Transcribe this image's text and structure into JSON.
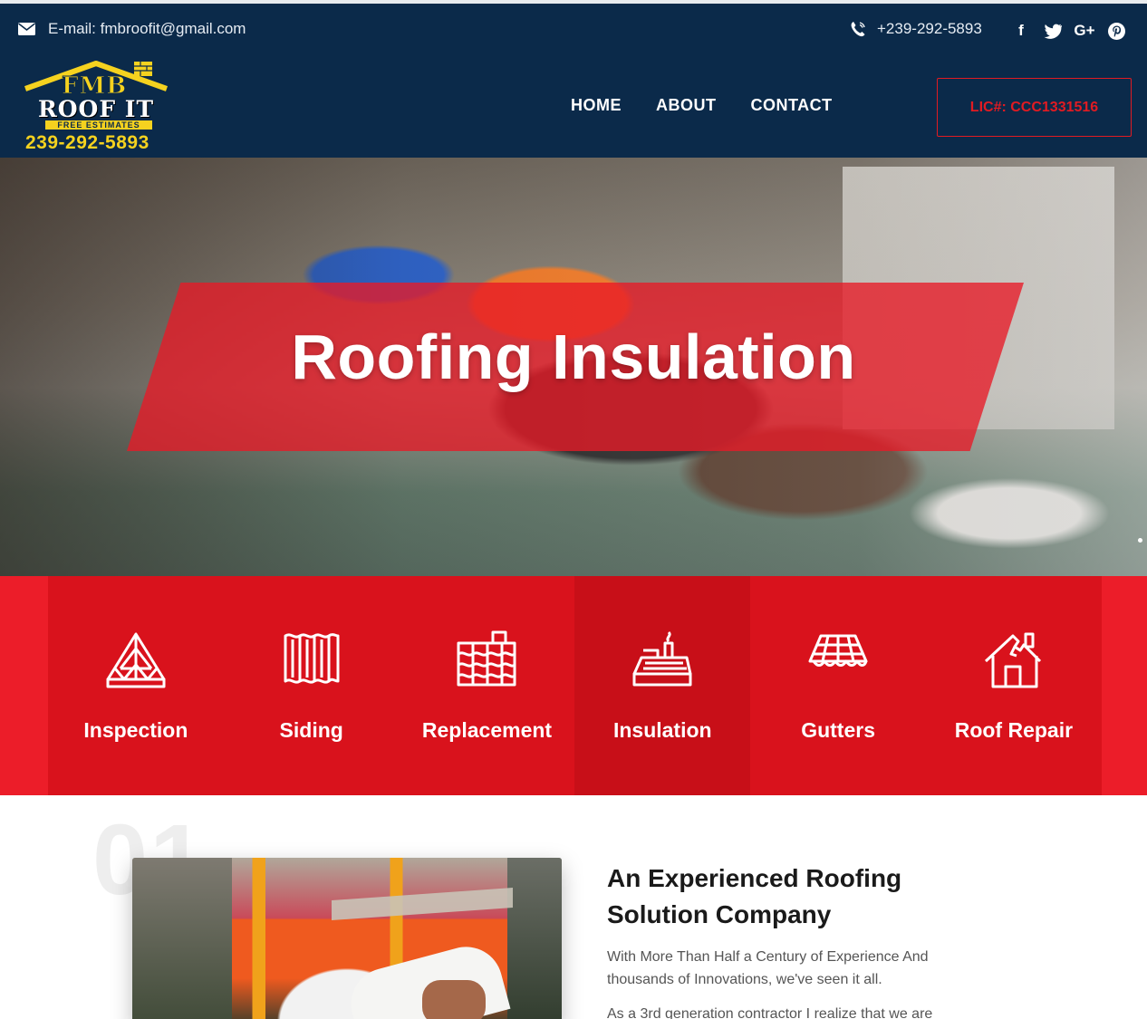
{
  "topbar": {
    "email_label": "E-mail: fmbroofit@gmail.com",
    "phone": "+239-292-5893",
    "social": {
      "facebook": "f",
      "twitter": "t",
      "google": "G+",
      "pinterest": "p"
    }
  },
  "logo": {
    "name_line1": "FMB",
    "name_line2": "ROOF IT",
    "tagline": "FREE ESTIMATES",
    "phone": "239-292-5893"
  },
  "nav": {
    "items": [
      "HOME",
      "ABOUT",
      "CONTACT"
    ]
  },
  "license_button": "LIC#: CCC1331516",
  "hero": {
    "title": "Roofing Insulation"
  },
  "services": [
    {
      "label": "Inspection",
      "icon": "roof-truss-icon"
    },
    {
      "label": "Siding",
      "icon": "siding-icon"
    },
    {
      "label": "Replacement",
      "icon": "roof-tiles-icon"
    },
    {
      "label": "Insulation",
      "icon": "insulation-icon",
      "active": true
    },
    {
      "label": "Gutters",
      "icon": "gutter-icon"
    },
    {
      "label": "Roof Repair",
      "icon": "house-repair-icon"
    }
  ],
  "about": {
    "number": "01",
    "title": "An Experienced Roofing Solution Company",
    "paragraph1": "With More Than Half a Century of Experience And thousands of Innovations, we've seen it all.",
    "paragraph2": "As a 3rd generation contractor I realize that we are"
  },
  "colors": {
    "header_bg": "#0b2a4a",
    "brand_red": "#e11b22",
    "logo_yellow": "#f5d21f"
  }
}
